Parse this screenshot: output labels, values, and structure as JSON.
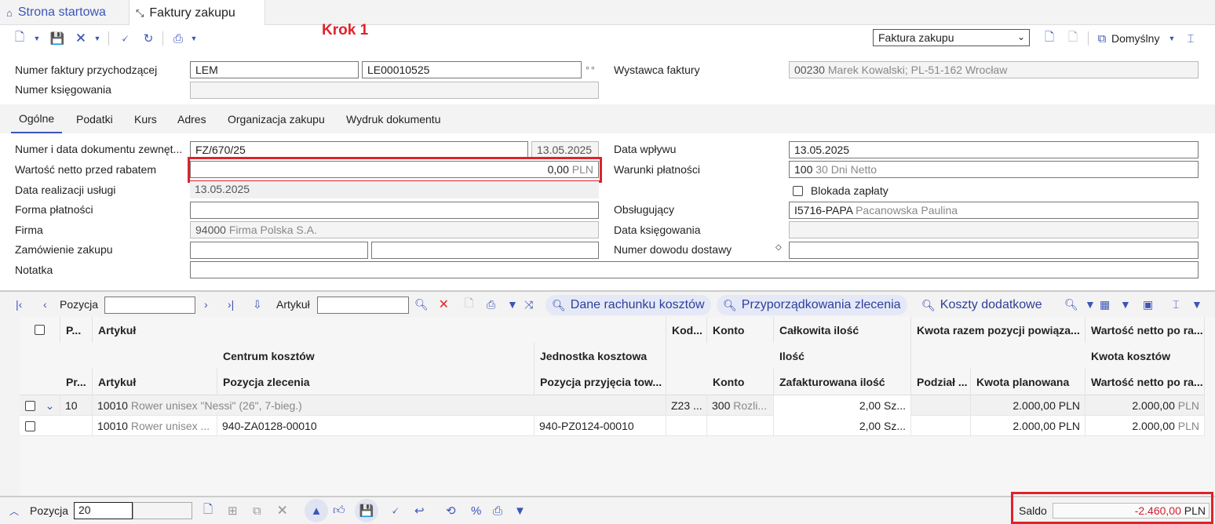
{
  "tabs": [
    {
      "label": "Strona startowa",
      "icon": "home-icon"
    },
    {
      "label": "Faktury zakupu",
      "icon": "collapse-icon"
    }
  ],
  "annotation": "Krok 1",
  "toolbar": {
    "doc_type": "Faktura zakupu",
    "view": "Domyślny"
  },
  "header": {
    "invoice_number_label": "Numer faktury przychodzącej",
    "invoice_prefix": "LEM",
    "invoice_number": "LE00010525",
    "posting_number_label": "Numer księgowania",
    "posting_number": "",
    "issuer_label": "Wystawca faktury",
    "issuer_code": "00230",
    "issuer_name": "Marek Kowalski; PL-51-162 Wrocław"
  },
  "form_tabs": [
    "Ogólne",
    "Podatki",
    "Kurs",
    "Adres",
    "Organizacja zakupu",
    "Wydruk dokumentu"
  ],
  "general": {
    "ext_doc_label": "Numer i data dokumentu zewnęt...",
    "ext_doc_number": "FZ/670/25",
    "ext_doc_date": "13.05.2025",
    "net_before_discount_label": "Wartość netto przed rabatem",
    "net_before_discount": "0,00",
    "net_currency": "PLN",
    "service_date_label": "Data realizacji usługi",
    "service_date": "13.05.2025",
    "payment_form_label": "Forma płatności",
    "payment_form": "",
    "company_label": "Firma",
    "company_code": "94000",
    "company_name": "Firma Polska S.A.",
    "purchase_order_label": "Zamówienie zakupu",
    "note_label": "Notatka",
    "receipt_date_label": "Data wpływu",
    "receipt_date": "13.05.2025",
    "payment_terms_label": "Warunki płatności",
    "payment_terms_code": "100",
    "payment_terms_name": "30 Dni Netto",
    "payment_block_label": "Blokada zapłaty",
    "handler_label": "Obsługujący",
    "handler_code": "I5716-PAPA",
    "handler_name": "Pacanowska Paulina",
    "posting_date_label": "Data księgowania",
    "delivery_proof_label": "Numer dowodu dostawy"
  },
  "grid_toolbar": {
    "position_label": "Pozycja",
    "article_label": "Artykuł",
    "btn_cost_data": "Dane rachunku kosztów",
    "btn_order_assign": "Przyporządkowania zlecenia",
    "btn_extra_costs": "Koszty dodatkowe"
  },
  "grid": {
    "headers_row1": [
      "P...",
      "Artykuł",
      "Kod...",
      "Konto",
      "Całkowita ilość",
      "Kwota razem pozycji powiąza...",
      "Wartość netto po ra..."
    ],
    "headers_row2": [
      "Centrum kosztów",
      "Jednostka kosztowa",
      "Ilość",
      "Kwota kosztów"
    ],
    "headers_row3": [
      "Pr...",
      "Artykuł",
      "Pozycja zlecenia",
      "Pozycja przyjęcia tow...",
      "Konto",
      "Zafakturowana ilość",
      "Podział ...",
      "Kwota planowana",
      "Wartość netto po ra..."
    ],
    "rows": [
      {
        "pos": "10",
        "article_code": "10010",
        "article_name": "Rower unisex \"Nessi\" (26\", 7-bieg.)",
        "code": "Z23 ...",
        "account_code": "300",
        "account_name": "Rozli...",
        "qty": "2,00 Sz...",
        "planned": "2.000,00 PLN",
        "net": "2.000,00",
        "currency": "PLN"
      },
      {
        "article_code": "10010",
        "article_name": "Rower unisex ...",
        "order_pos": "940-ZA0128-00010",
        "receipt_pos": "940-PZ0124-00010",
        "qty": "2,00 Sz...",
        "planned": "2.000,00 PLN",
        "net": "2.000,00",
        "currency": "PLN"
      }
    ]
  },
  "bottom": {
    "position_label": "Pozycja",
    "position_value": "20",
    "saldo_label": "Saldo",
    "saldo_value": "-2.460,00",
    "saldo_currency": "PLN"
  },
  "colors": {
    "accent": "#3d55b8",
    "highlight": "#e0222a"
  }
}
